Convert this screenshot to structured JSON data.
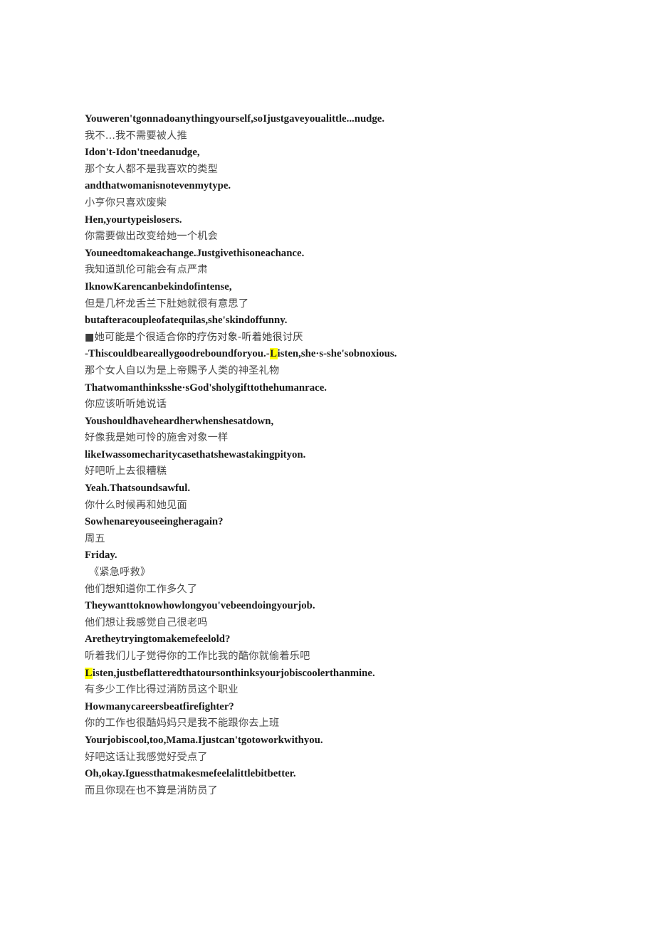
{
  "document": {
    "type": "bilingual-subtitle-transcript",
    "background_color": "#ffffff",
    "english_text_color": "#1b1b1b",
    "chinese_text_color": "#4a4a4a",
    "highlight_color": "#ffff00",
    "bullet_marker": "■",
    "show_title": "《紧急呼救》"
  },
  "lines": [
    {
      "lang": "en",
      "text": "Youweren'tgonnadoanythingyourself,soIjustgaveyoualittle...nudge."
    },
    {
      "lang": "zh",
      "text": "我不…我不需要被人推"
    },
    {
      "lang": "en",
      "text": "Idon't-Idon'tneedanudge,"
    },
    {
      "lang": "zh",
      "text": "那个女人都不是我喜欢的类型"
    },
    {
      "lang": "en",
      "text": "andthatwomanisnotevenmytype."
    },
    {
      "lang": "zh",
      "text": "小亨你只喜欢废柴"
    },
    {
      "lang": "en",
      "text": "Hen,yourtypeislosers."
    },
    {
      "lang": "zh",
      "text": "你需要做出改变给她一个机会"
    },
    {
      "lang": "en",
      "text": "Youneedtomakeachange.Justgivethisoneachance."
    },
    {
      "lang": "zh",
      "text": "我知道凯伦可能会有点严肃"
    },
    {
      "lang": "en",
      "text": "IknowKarencanbekindofintense,"
    },
    {
      "lang": "zh",
      "text": "但是几杯龙舌兰下肚她就很有意思了"
    },
    {
      "lang": "en",
      "text": "butafteracoupleofatequilas,she'skindoffunny."
    },
    {
      "lang": "zh",
      "marker": true,
      "text": "■她可能是个很适合你的疗伤对象-听着她很讨厌"
    },
    {
      "lang": "en",
      "highlight_prefix": "L",
      "pre": "-Thiscouldbeareallygoodreboundforyou.-",
      "post": "isten,she·s-she'sobnoxious."
    },
    {
      "lang": "zh",
      "text": "那个女人自以为是上帝赐予人类的神圣礼物"
    },
    {
      "lang": "en",
      "text": "Thatwomanthinksshe·sGod'sholygifttothehumanrace."
    },
    {
      "lang": "zh",
      "text": "你应该听听她说话"
    },
    {
      "lang": "en",
      "text": "Youshouldhaveheardherwhenshesatdown,"
    },
    {
      "lang": "zh",
      "text": "好像我是她可怜的施舍对象一样"
    },
    {
      "lang": "en",
      "text": "likeIwassomecharitycasethatshewastakingpityon."
    },
    {
      "lang": "zh",
      "text": "好吧听上去很糟糕"
    },
    {
      "lang": "en",
      "text": "Yeah.Thatsoundsawful."
    },
    {
      "lang": "zh",
      "text": "你什么时候再和她见面"
    },
    {
      "lang": "en",
      "text": "Sowhenareyouseeingheragain?"
    },
    {
      "lang": "zh",
      "text": "周五"
    },
    {
      "lang": "en",
      "text": "Friday."
    },
    {
      "lang": "zh",
      "title": true,
      "text": "《紧急呼救》"
    },
    {
      "lang": "zh",
      "text": "他们想知道你工作多久了"
    },
    {
      "lang": "en",
      "text": "Theywanttoknowhowlongyou'vebeendoingyourjob."
    },
    {
      "lang": "zh",
      "text": "他们想让我感觉自己很老吗"
    },
    {
      "lang": "en",
      "text": "Aretheytryingtomakemefeelold?"
    },
    {
      "lang": "zh",
      "text": "听着我们儿子觉得你的工作比我的酷你就偷着乐吧"
    },
    {
      "lang": "en",
      "highlight_prefix": "L",
      "pre": "",
      "post": "isten,justbeflatteredthatoursonthinksyourjobiscoolerthanmine."
    },
    {
      "lang": "zh",
      "text": "有多少工作比得过消防员这个职业"
    },
    {
      "lang": "en",
      "text": "Howmanycareersbeatfirefighter?"
    },
    {
      "lang": "zh",
      "text": "你的工作也很酷妈妈只是我不能跟你去上班"
    },
    {
      "lang": "en",
      "text": "Yourjobiscool,too,Mama.Ijustcan'tgotoworkwithyou."
    },
    {
      "lang": "zh",
      "text": "好吧这话让我感觉好受点了"
    },
    {
      "lang": "en",
      "text": "Oh,okay.Iguessthatmakesmefeelalittlebitbetter."
    },
    {
      "lang": "zh",
      "text": "而且你现在也不算是消防员了"
    }
  ]
}
